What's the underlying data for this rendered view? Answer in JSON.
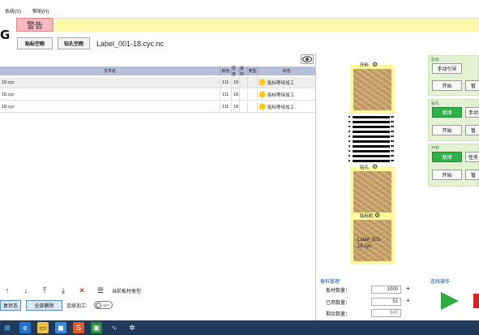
{
  "menu": {
    "items": [
      "系统(S)",
      "帮助(H)"
    ]
  },
  "header": {
    "logo_letter": "G",
    "warning_label": "警告",
    "btn_label_empty": "贴标空跑",
    "btn_drill_empty": "钻孔空跑",
    "filename": "Label_001-18.cyc.nc"
  },
  "table": {
    "columns": [
      "文件名",
      "颜色",
      "厚度",
      "板材",
      "类型",
      "状态"
    ],
    "rows": [
      {
        "name": "18.cyc",
        "color": "111",
        "thickness": "18",
        "status": "贴标等待加工"
      },
      {
        "name": "18.cyc",
        "color": "111",
        "thickness": "18",
        "status": "贴标等待加工"
      },
      {
        "name": "18.cyc",
        "color": "111",
        "thickness": "18",
        "status": "贴标等待加工"
      }
    ]
  },
  "bottom": {
    "plate_type_label": "当前板材类型:",
    "reset_status_btn": "复状态",
    "delete_all_btn": "全部删除",
    "continuous_label": "连续加工:",
    "toggle_state": "OFF"
  },
  "machine": {
    "station_top": "开料",
    "station_mid": "钻孔",
    "station_bottom": "贴标机",
    "bottom_station_text": "Label_001-18.cyc"
  },
  "controls": {
    "group1": {
      "title": "贴标",
      "btn_manual": "手动引导",
      "btn_start": "开始",
      "btn_pause": "暂"
    },
    "group2": {
      "title": "钻孔",
      "btn_ready": "就绪",
      "btn_manual": "手动",
      "btn_start": "开始",
      "btn_pause": "暂"
    },
    "group3": {
      "title": "开料",
      "btn_ready": "就绪",
      "btn_task": "任务",
      "btn_start": "开始",
      "btn_pause": "暂"
    }
  },
  "stock": {
    "title": "备料管理",
    "count_label": "板材数量：",
    "count_value": "1000",
    "used_label": "已用数量：",
    "used_value": "51",
    "remaining_label": "剩余数量：",
    "remaining_value": "949"
  },
  "connection": {
    "title": "连线操作"
  },
  "colors": {
    "warning_bg": "#fff8a8",
    "warning_label": "#f7b8c0",
    "green": "#2fb14c",
    "table_head": "#b7bfd8",
    "taskbar": "#1f3a5c"
  }
}
